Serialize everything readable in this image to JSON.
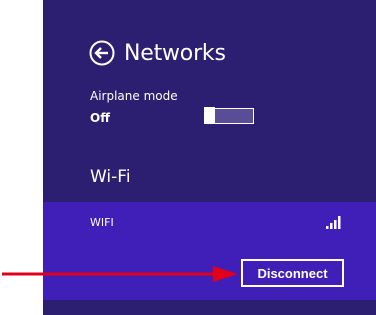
{
  "panel": {
    "title": "Networks",
    "back_icon": "back-arrow-circle-icon",
    "background_color": "#2c1f72",
    "selected_block_color": "#3f1fb7"
  },
  "airplane_mode": {
    "label": "Airplane mode",
    "state": "Off",
    "is_on": false
  },
  "wifi_section": {
    "heading": "Wi-Fi",
    "networks": [
      {
        "name": "WIFI",
        "signal_icon": "signal-strength-icon",
        "signal_bars": 4,
        "action_label": "Disconnect"
      }
    ]
  },
  "annotation": {
    "arrow_color": "#e0001b",
    "points_to": "Disconnect"
  }
}
